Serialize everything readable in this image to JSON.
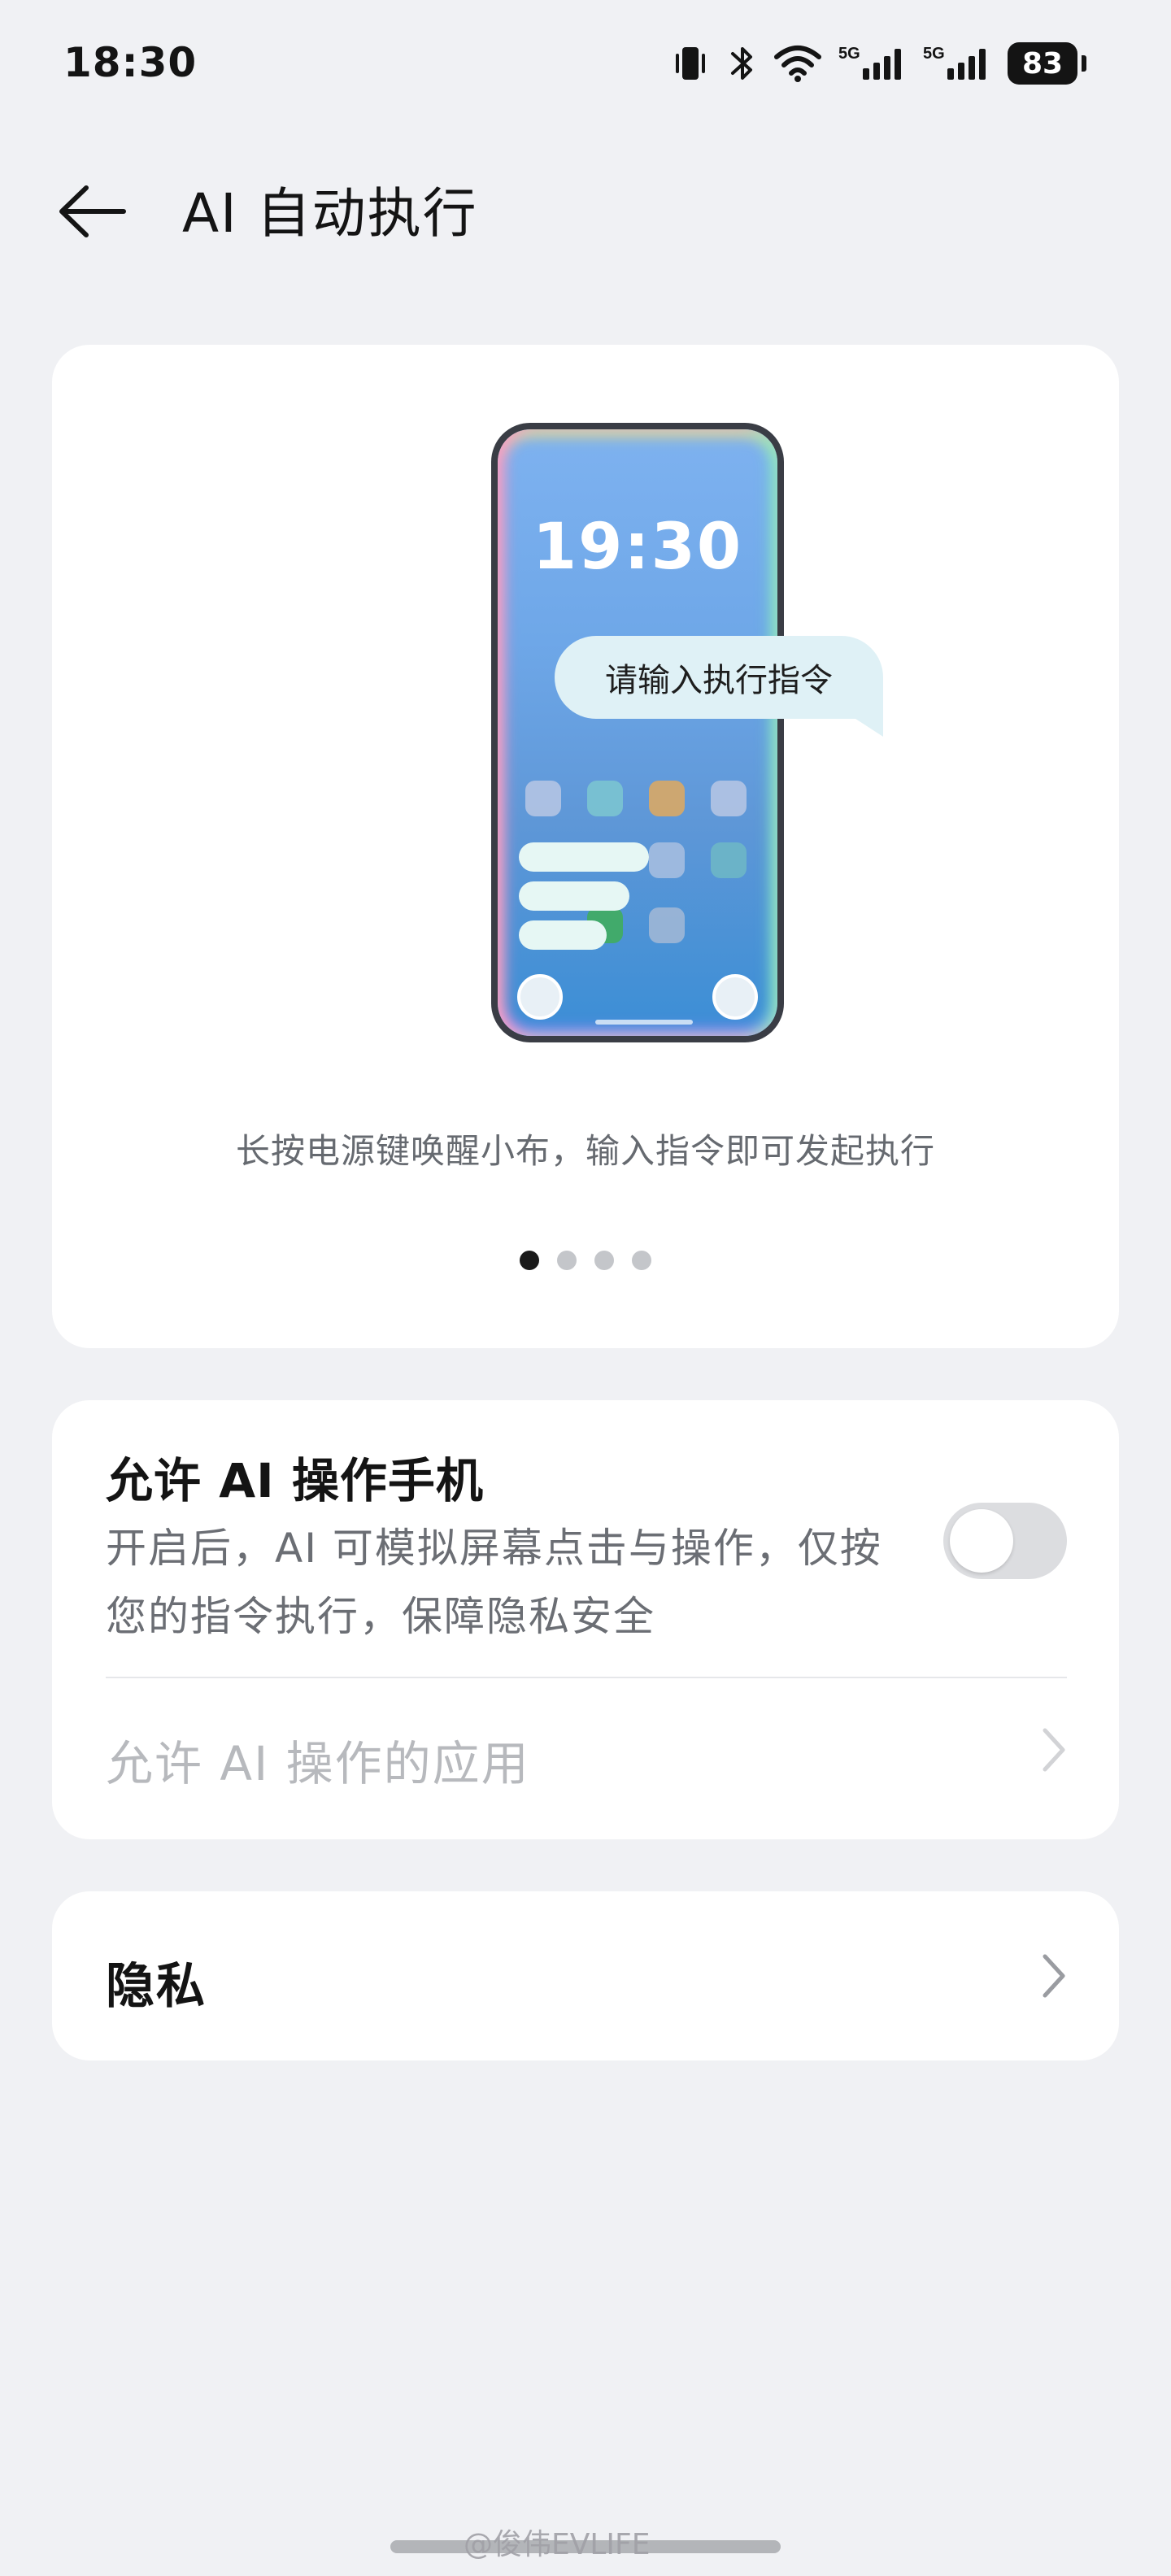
{
  "status_bar": {
    "time": "18:30",
    "battery": "83",
    "network_labels": [
      "5G",
      "5G"
    ],
    "icons": [
      "vibrate-icon",
      "bluetooth-icon",
      "wifi-icon",
      "signal-5g-icon",
      "signal-5g-icon",
      "battery-icon"
    ]
  },
  "header": {
    "title": "AI 自动执行",
    "back_icon": "arrow-left-icon"
  },
  "hero": {
    "phone_clock": "19:30",
    "prompt": "请输入执行指令",
    "caption": "长按电源键唤醒小布，输入指令即可发起执行",
    "pager": {
      "total": 4,
      "active": 1
    }
  },
  "permission": {
    "title": "允许 AI 操作手机",
    "description": "开启后，AI 可模拟屏幕点击与操作，仅按您的指令执行，保障隐私安全",
    "toggle_on": false,
    "apps_label": "允许 AI 操作的应用"
  },
  "privacy": {
    "label": "隐私"
  },
  "watermark": "@俊伟EVLIFE",
  "colors": {
    "background": "#f0f1f4",
    "card": "#ffffff",
    "text_primary": "#141414",
    "text_secondary": "#6b6e74",
    "text_disabled": "#b7b9bd",
    "toggle_off": "#dcdde0"
  }
}
